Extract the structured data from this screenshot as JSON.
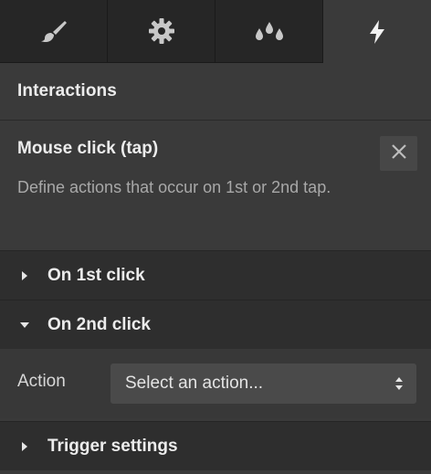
{
  "tabs": [
    {
      "icon": "brush-icon",
      "active": false
    },
    {
      "icon": "gear-icon",
      "active": false
    },
    {
      "icon": "drops-icon",
      "active": false
    },
    {
      "icon": "lightning-icon",
      "active": true
    }
  ],
  "panel": {
    "title": "Interactions",
    "trigger": {
      "name": "Mouse click (tap)",
      "description": "Define actions that occur on 1st or 2nd tap."
    },
    "sections": {
      "first_click": {
        "label": "On 1st click",
        "expanded": false
      },
      "second_click": {
        "label": "On 2nd click",
        "expanded": true
      },
      "trigger_settings": {
        "label": "Trigger settings",
        "expanded": false
      }
    },
    "action": {
      "label": "Action",
      "select_value": "Select an action..."
    }
  }
}
